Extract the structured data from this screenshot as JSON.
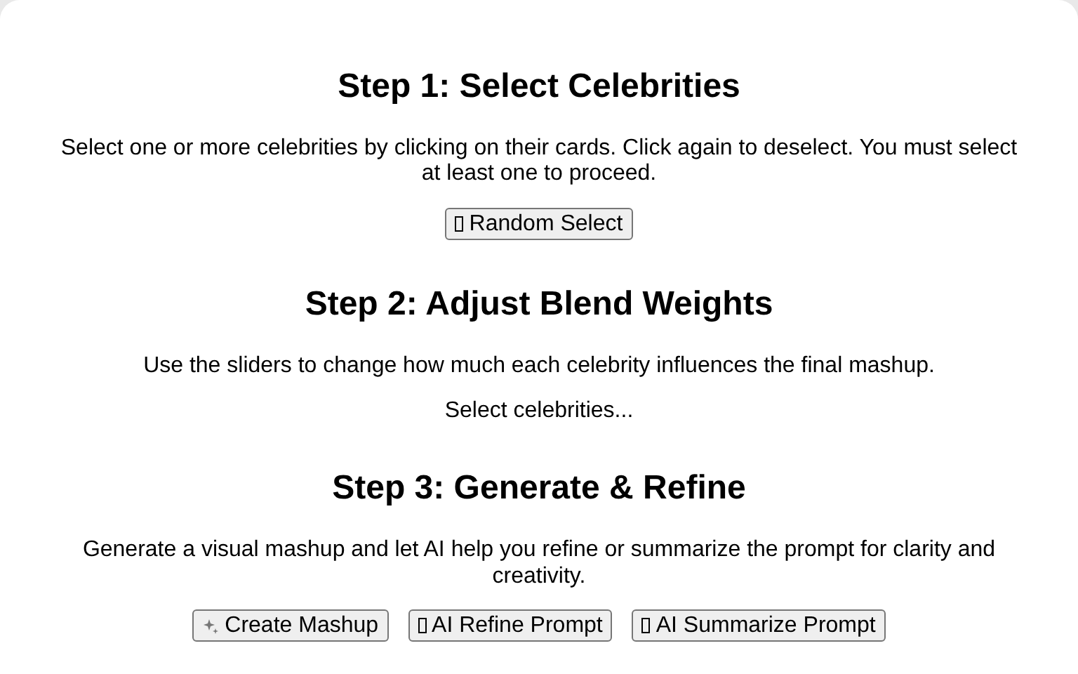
{
  "steps": [
    {
      "title": "Step 1: Select Celebrities",
      "description": "Select one or more celebrities by clicking on their cards. Click again to deselect. You must select at least one to proceed.",
      "buttons": [
        {
          "label": "Random Select",
          "kind": "glyph"
        }
      ]
    },
    {
      "title": "Step 2: Adjust Blend Weights",
      "description": "Use the sliders to change how much each celebrity influences the final mashup.",
      "status": "Select celebrities..."
    },
    {
      "title": "Step 3: Generate & Refine",
      "description": "Generate a visual mashup and let AI help you refine or summarize the prompt for clarity and creativity.",
      "buttons": [
        {
          "label": "Create Mashup",
          "kind": "sparkle"
        },
        {
          "label": "AI Refine Prompt",
          "kind": "glyph"
        },
        {
          "label": "AI Summarize Prompt",
          "kind": "glyph"
        }
      ]
    }
  ]
}
